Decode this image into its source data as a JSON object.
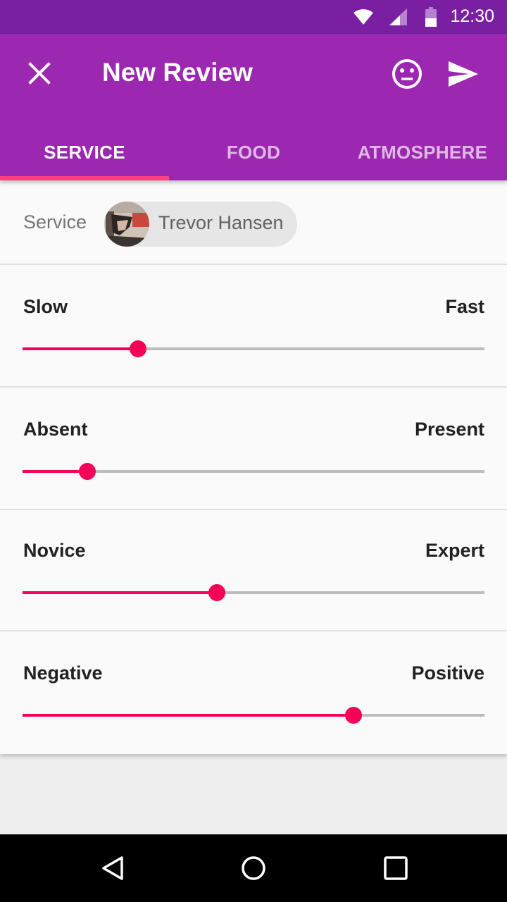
{
  "status_bar": {
    "time": "12:30",
    "icons": [
      "wifi-icon",
      "cell-signal-icon",
      "battery-icon"
    ]
  },
  "app_bar": {
    "title": "New Review",
    "close_icon": "close-icon",
    "actions": [
      "neutral-face-icon",
      "send-icon"
    ]
  },
  "tabs": [
    {
      "label": "SERVICE",
      "active": true
    },
    {
      "label": "FOOD",
      "active": false
    },
    {
      "label": "ATMOSPHERE",
      "active": false
    }
  ],
  "service": {
    "label": "Service",
    "chip_name": "Trevor Hansen"
  },
  "sliders": [
    {
      "left_label": "Slow",
      "right_label": "Fast",
      "value": 0.25
    },
    {
      "left_label": "Absent",
      "right_label": "Present",
      "value": 0.14
    },
    {
      "left_label": "Novice",
      "right_label": "Expert",
      "value": 0.42
    },
    {
      "left_label": "Negative",
      "right_label": "Positive",
      "value": 0.716
    }
  ],
  "colors": {
    "status_bar": "#7b1fa2",
    "primary": "#9c27b0",
    "accent": "#f50057",
    "tab_indicator": "#ff4081",
    "track": "#bdbdbd"
  },
  "nav_bar": {
    "icons": [
      "back-icon",
      "home-icon",
      "recents-icon"
    ]
  }
}
